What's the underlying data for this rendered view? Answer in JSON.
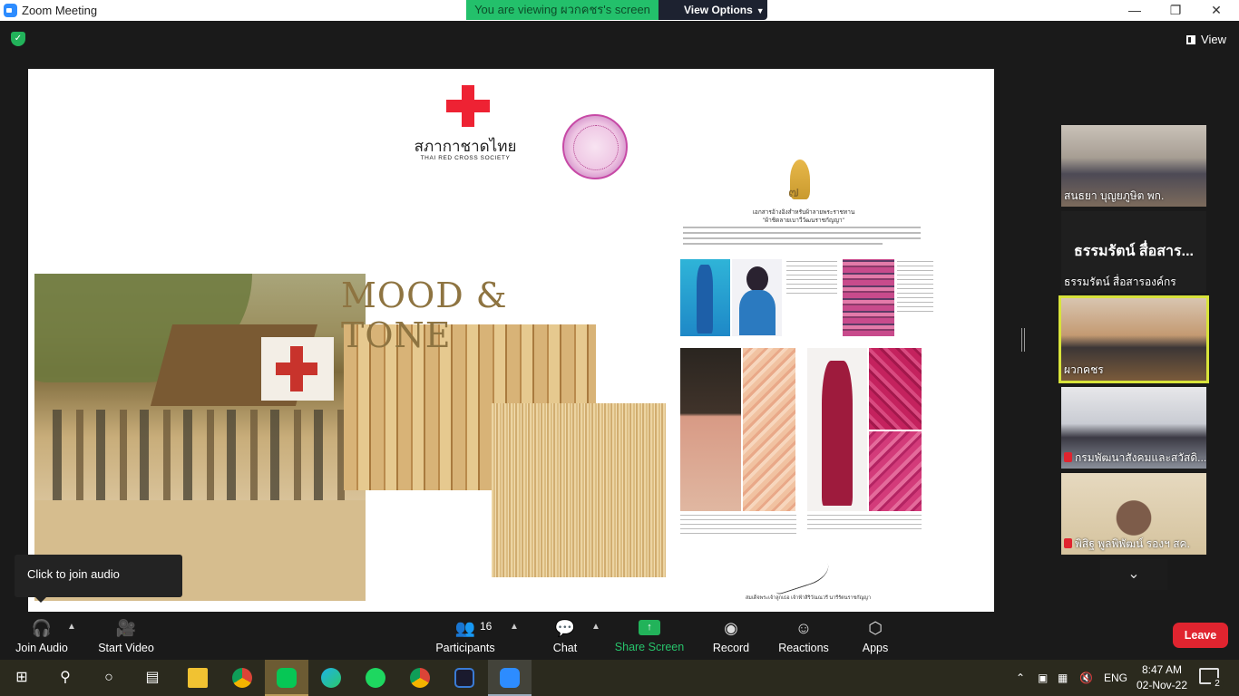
{
  "window": {
    "title": "Zoom Meeting",
    "minimize": "—",
    "maximize": "❐",
    "close": "✕"
  },
  "banner": {
    "viewing_text": "You are viewing ผวกคชร's screen",
    "view_options": "View Options"
  },
  "top_right": {
    "view_label": "View"
  },
  "slide": {
    "org_thai": "สภากาชาดไทย",
    "org_en": "THAI RED CROSS SOCIETY",
    "mood_title": "MOOD & TONE",
    "doc_number": "๗",
    "doc_title_1": "เอกสารอ้างอิงสำหรับผ้าลายพระราชทาน",
    "doc_title_2": "\"ผ้าชิดลายเบาวีวัฒนราชกัญญา\"",
    "signature_caption": "สมเด็จพระเจ้าลูกเธอ เจ้าฟ้าสิริวัณณวรี นารีรัตนราชกัญญา"
  },
  "participants_panel": [
    {
      "name": "สนธยา บุญยภูษิต พก.",
      "muted": false
    },
    {
      "name": "ธรรมรัตน์ สื่อสารองค์กร",
      "big_name": "ธรรมรัตน์ สื่อสาร...",
      "muted": false
    },
    {
      "name": "ผวกคชร",
      "muted": false,
      "active": true
    },
    {
      "name": "กรมพัฒนาสังคมและสวัสดิ...",
      "muted": true
    },
    {
      "name": "พิสิฐ พูลพิพัฒน์ รองฯ สค.",
      "muted": true
    }
  ],
  "tooltip": {
    "text": "Click to join audio"
  },
  "toolbar": {
    "join_audio": "Join Audio",
    "start_video": "Start Video",
    "participants": "Participants",
    "participants_count": "16",
    "chat": "Chat",
    "share_screen": "Share Screen",
    "record": "Record",
    "reactions": "Reactions",
    "apps": "Apps",
    "leave": "Leave"
  },
  "taskbar": {
    "language": "ENG",
    "time": "8:47 AM",
    "date": "02-Nov-22",
    "notifications": "2"
  },
  "colors": {
    "zoom_blue": "#2d8cff",
    "banner_green": "#23c06b",
    "leave_red": "#e0242f",
    "active_speaker": "#d8e33a",
    "redcross": "#ee2233"
  }
}
